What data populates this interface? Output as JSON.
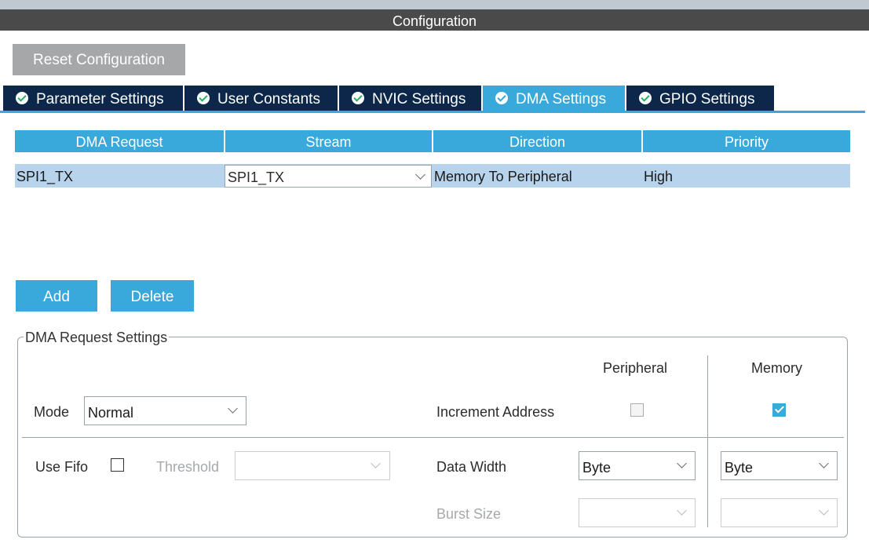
{
  "window": {
    "title": "Configuration"
  },
  "toolbar": {
    "reset_label": "Reset Configuration"
  },
  "tabs": [
    {
      "label": "Parameter Settings",
      "active": false
    },
    {
      "label": "User Constants",
      "active": false
    },
    {
      "label": "NVIC Settings",
      "active": false
    },
    {
      "label": "DMA Settings",
      "active": true
    },
    {
      "label": "GPIO Settings",
      "active": false
    }
  ],
  "table": {
    "columns": [
      "DMA Request",
      "Stream",
      "Direction",
      "Priority"
    ],
    "rows": [
      {
        "request": "SPI1_TX",
        "stream": "SPI1_TX",
        "direction": "Memory To Peripheral",
        "priority": "High"
      }
    ]
  },
  "actions": {
    "add_label": "Add",
    "delete_label": "Delete"
  },
  "settings": {
    "legend": "DMA Request Settings",
    "peripheral_header": "Peripheral",
    "memory_header": "Memory",
    "mode_label": "Mode",
    "mode_value": "Normal",
    "increment_label": "Increment Address",
    "increment_peripheral": false,
    "increment_memory": true,
    "use_fifo_label": "Use Fifo",
    "use_fifo": false,
    "threshold_label": "Threshold",
    "threshold_value": "",
    "data_width_label": "Data Width",
    "data_width_peripheral": "Byte",
    "data_width_memory": "Byte",
    "burst_size_label": "Burst Size",
    "burst_peripheral": "",
    "burst_memory": ""
  },
  "colors": {
    "accent": "#39a8db",
    "tab_dark": "#0c2749",
    "title_bar": "#4a4a4a",
    "row_selected": "#b8d3ec"
  }
}
